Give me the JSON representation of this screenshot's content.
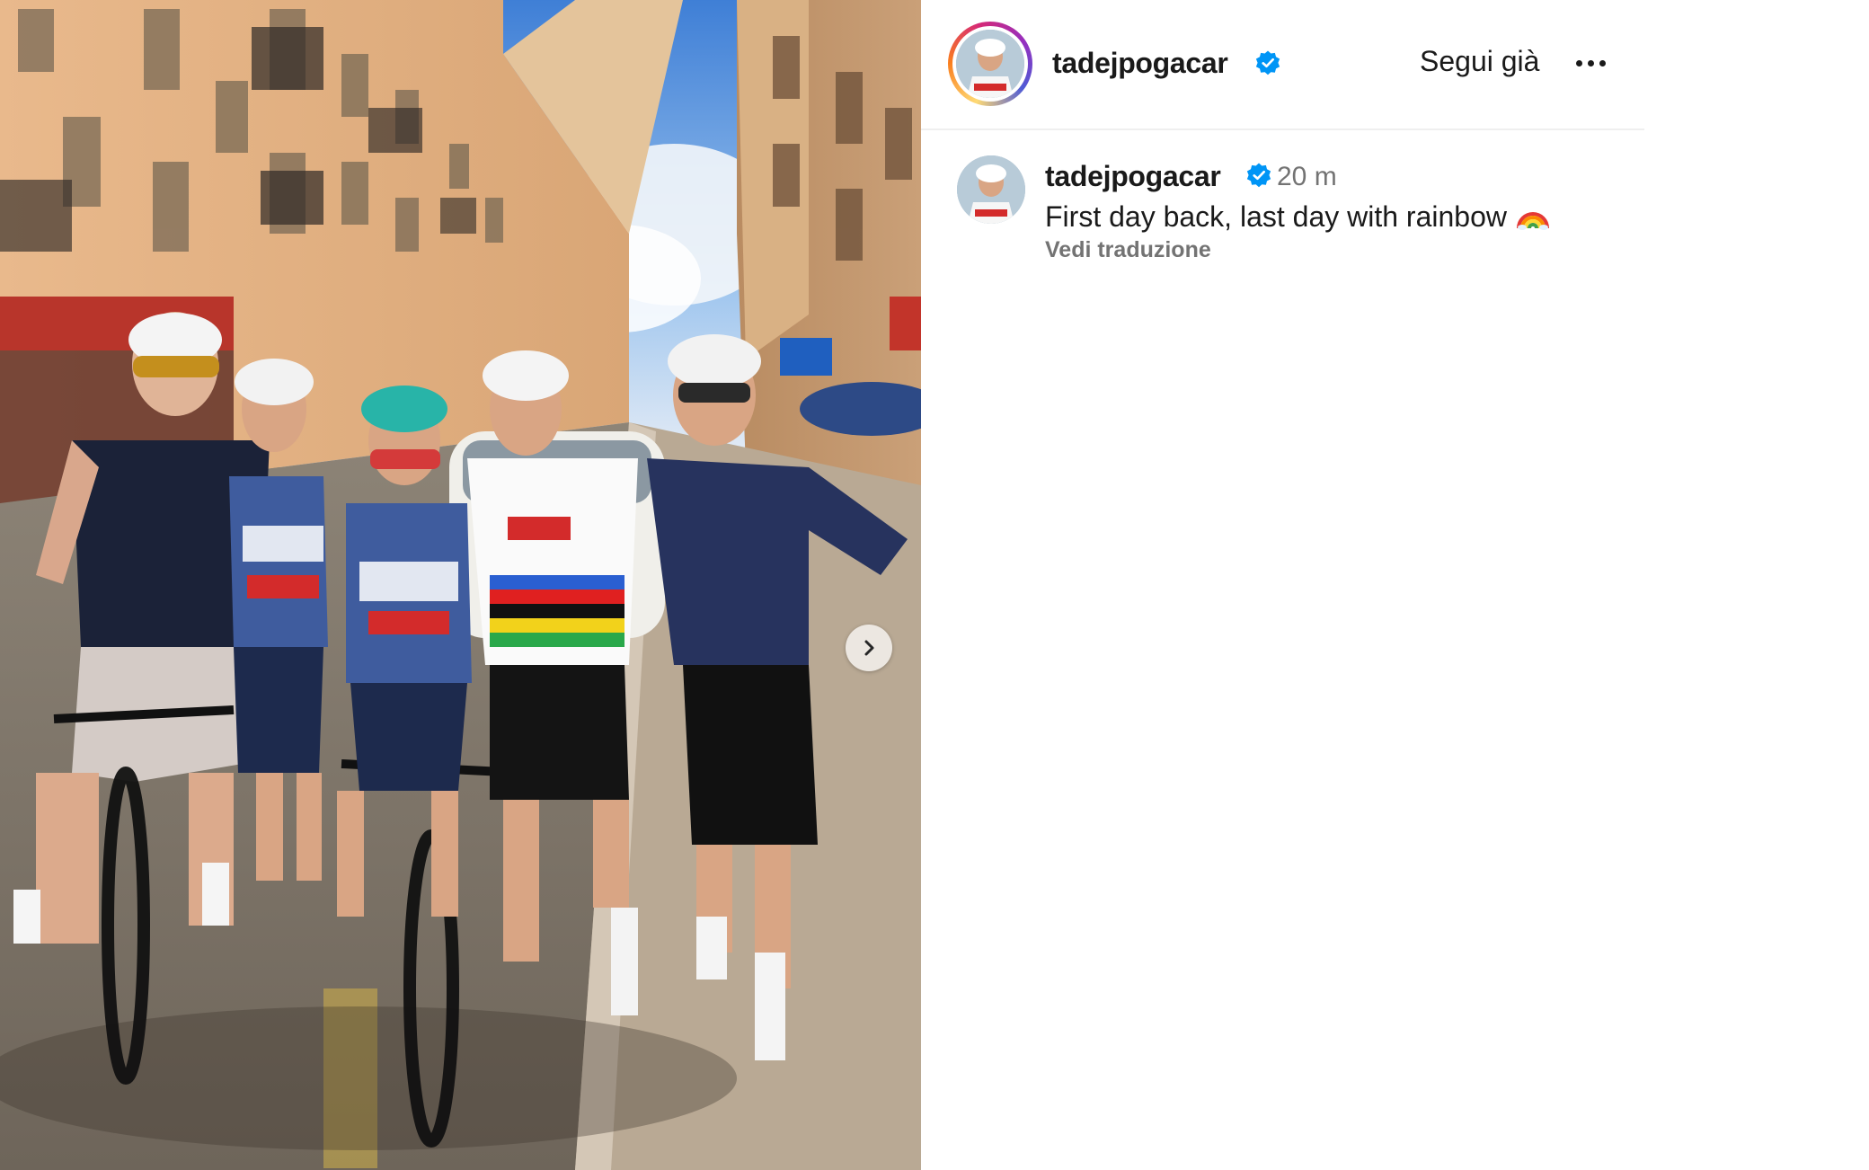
{
  "post": {
    "username": "tadejpogacar",
    "follow_label": "Segui già",
    "caption_username": "tadejpogacar",
    "timestamp": "20 m",
    "caption_text": "First day back, last day with rainbow",
    "translate_label": "Vedi traduzione"
  },
  "icons": {
    "verified": "verified-badge-icon",
    "more": "more-options-icon",
    "next": "chevron-right-icon",
    "emoji": "rainbow-emoji"
  },
  "colors": {
    "verified_blue": "#0095f6",
    "text_primary": "#1a1a1a",
    "text_secondary": "#737373",
    "divider": "#efefef"
  }
}
